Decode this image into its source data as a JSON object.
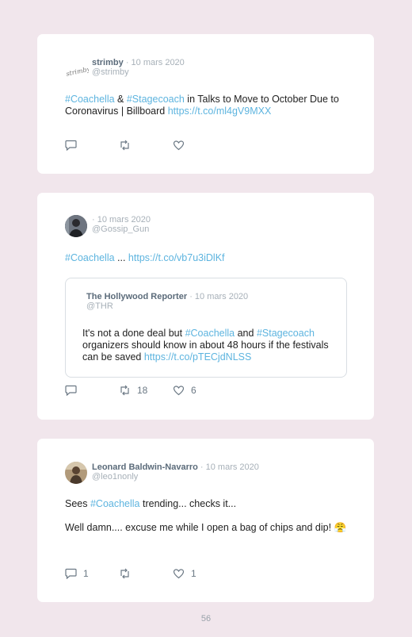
{
  "tweets": [
    {
      "name": "strimby",
      "date": "· 10 mars 2020",
      "handle": "@strimby",
      "logo_text": "strimby",
      "text": {
        "tag1": "#Coachella",
        "amp": " & ",
        "tag2": "#Stagecoach",
        "rest": " in Talks to Move to October Due to Coronavirus | Billboard ",
        "link": "https://t.co/ml4gV9MXX"
      },
      "reply_count": "",
      "retweet_count": "",
      "like_count": ""
    },
    {
      "name": "",
      "date": "· 10 mars 2020",
      "handle": "@Gossip_Gun",
      "text": {
        "tag1": "#Coachella",
        "rest": " ... ",
        "link": "https://t.co/vb7u3iDlKf"
      },
      "quote": {
        "name": "The Hollywood Reporter",
        "date": "· 10 mars 2020",
        "handle": "@THR",
        "t1": "It's not a done deal but ",
        "tag1": "#Coachella",
        "t2": " and ",
        "tag2": "#Stagecoach",
        "t3": " organizers should know in about 48 hours if the festivals can be saved ",
        "link": "https://t.co/pTECjdNLSS"
      },
      "reply_count": "",
      "retweet_count": "18",
      "like_count": "6"
    },
    {
      "name": "Leonard Baldwin-Navarro",
      "date": "· 10 mars 2020",
      "handle": "@leo1nonly",
      "text": {
        "t1": "Sees ",
        "tag1": "#Coachella",
        "t2": " trending... checks it...",
        "para2": "Well damn.... excuse me while I open a bag of chips and dip! 😤"
      },
      "reply_count": "1",
      "retweet_count": "",
      "like_count": "1"
    }
  ],
  "page_number": "56",
  "colors": {
    "background": "#f1e6ec",
    "card": "#ffffff",
    "link": "#5db4df"
  },
  "icons": [
    "reply-icon",
    "retweet-icon",
    "like-icon"
  ]
}
